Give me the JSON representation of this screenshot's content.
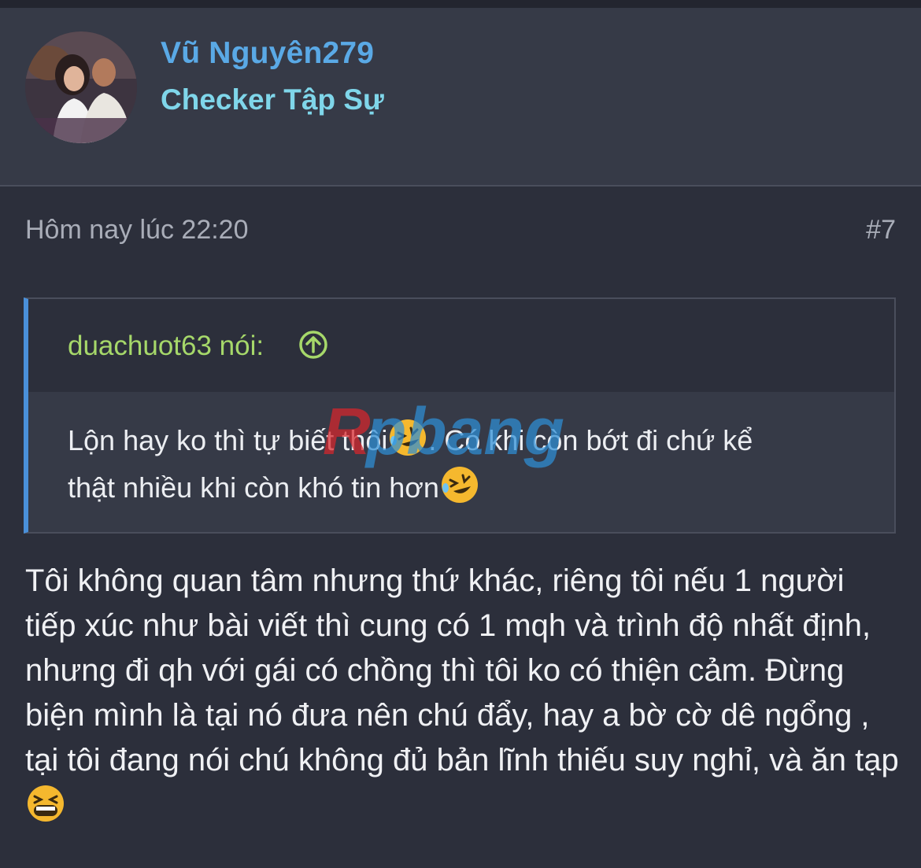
{
  "user": {
    "name": "Vũ Nguyên279",
    "title": "Checker Tập Sự"
  },
  "post": {
    "timestamp": "Hôm nay lúc 22:20",
    "number": "#7",
    "quote": {
      "author": "duachuot63 nói:",
      "line1_text": "Lộn hay ko thì tự biết thôi",
      "line1_after": ". Có khi còn bớt đi chứ kể",
      "line2_text": "thật nhiều khi còn khó tin hơn"
    },
    "body_text": "Tôi không quan tâm nhưng thứ khác, riêng tôi nếu 1 người tiếp xúc như bài viết thì cung có 1 mqh và trình độ nhất định, nhưng đi qh với gái có chồng thì tôi ko có thiện cảm. Đừng biện mình là tại nó đưa nên chú đẩy, hay a bờ cờ dê ngổng , tại tôi đang nói chú không đủ bản lĩnh thiếu suy nghỉ, và ăn tạp "
  },
  "watermark": {
    "text": "Rpbang"
  },
  "colors": {
    "username": "#5aa9e6",
    "usertitle": "#7fd6ea",
    "quote_author": "#a6d86a",
    "quote_bar": "#4a90d9",
    "background": "#2c2f3b"
  },
  "icons": {
    "quote_jump": "arrow-up-circle-icon",
    "emoji_laugh": "rolling-laughing-emoji",
    "emoji_grin": "grinning-squint-emoji"
  }
}
